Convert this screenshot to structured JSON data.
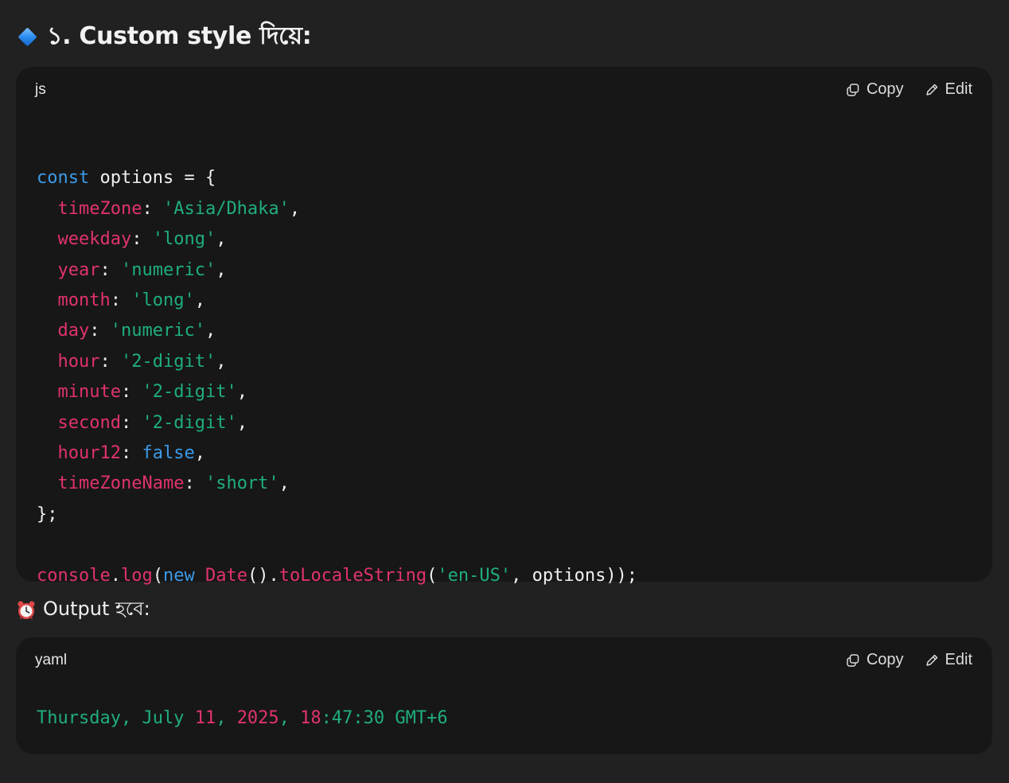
{
  "heading": {
    "icon": "blue-diamond-icon",
    "text": "১. Custom style দিয়ে:"
  },
  "code_js": {
    "language": "js",
    "copy_label": "Copy",
    "edit_label": "Edit",
    "lines": [
      "",
      "const options = {",
      "  timeZone: 'Asia/Dhaka',",
      "  weekday: 'long',",
      "  year: 'numeric',",
      "  month: 'long',",
      "  day: 'numeric',",
      "  hour: '2-digit',",
      "  minute: '2-digit',",
      "  second: '2-digit',",
      "  hour12: false,",
      "  timeZoneName: 'short',",
      "};",
      "",
      "console.log(new Date().toLocaleString('en-US', options));"
    ]
  },
  "output_heading": {
    "icon": "alarm-clock-icon",
    "text": "Output হবে:"
  },
  "code_yaml": {
    "language": "yaml",
    "copy_label": "Copy",
    "edit_label": "Edit",
    "lines": [
      "",
      "Thursday, July 11, 2025, 18:47:30 GMT+6"
    ]
  },
  "colors": {
    "background": "#212121",
    "code_background": "#171717",
    "keyword": "#3b9ae8",
    "property": "#e0336b",
    "string": "#1fae7d"
  }
}
